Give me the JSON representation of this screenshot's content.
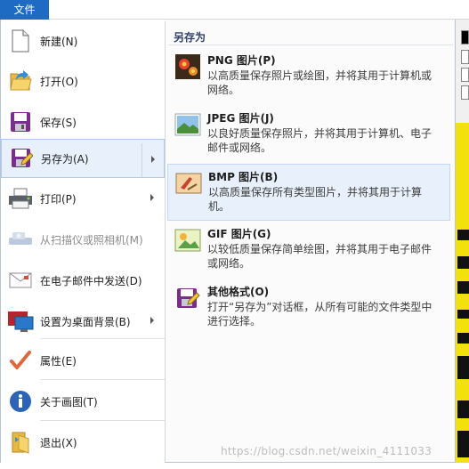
{
  "tab": {
    "file": "文件"
  },
  "left_menu": {
    "new": "新建(N)",
    "open": "打开(O)",
    "save": "保存(S)",
    "save_as": "另存为(A)",
    "print": "打印(P)",
    "scanner": "从扫描仪或照相机(M)",
    "email": "在电子邮件中发送(D)",
    "wallpaper": "设置为桌面背景(B)",
    "properties": "属性(E)",
    "about": "关于画图(T)",
    "exit": "退出(X)"
  },
  "right_panel": {
    "title": "另存为",
    "formats": {
      "png": {
        "title": "PNG 图片(P)",
        "desc": "以高质量保存照片或绘图，并将其用于计算机或网络。"
      },
      "jpeg": {
        "title": "JPEG 图片(J)",
        "desc": "以良好质量保存照片，并将其用于计算机、电子邮件或网络。"
      },
      "bmp": {
        "title": "BMP 图片(B)",
        "desc": "以高质量保存所有类型图片，并将其用于计算机。"
      },
      "gif": {
        "title": "GIF 图片(G)",
        "desc": "以较低质量保存简单绘图，并将其用于电子邮件或网络。"
      },
      "other": {
        "title": "其他格式(O)",
        "desc": "打开“另存为”对话框，从所有可能的文件类型中进行选择。"
      }
    }
  },
  "watermark": "https://blog.csdn.net/weixin_4111033",
  "colors": {
    "accent": "#1e6bc4",
    "selection": "#e8f1fb",
    "background_image": "#f2e10a"
  },
  "state": {
    "selected_item": "save_as",
    "highlighted_format": "bmp",
    "disabled_items": [
      "scanner"
    ]
  }
}
